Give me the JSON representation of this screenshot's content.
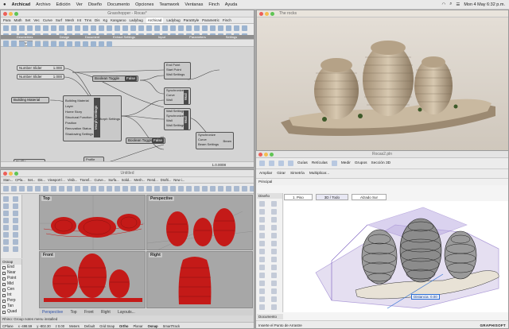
{
  "menubar": {
    "app": "Archicad",
    "items": [
      "Archivo",
      "Edición",
      "Ver",
      "Diseño",
      "Documento",
      "Opciones",
      "Teamwork",
      "Ventanas",
      "Finch",
      "Ayuda"
    ],
    "datetime": "Mon 4 May 6:32 p.m."
  },
  "gh": {
    "title": "Grasshopper - Rocas*",
    "tabs": [
      "Para",
      "Math",
      "Set",
      "Vec",
      "Curve",
      "Surf",
      "Mesh",
      "Int",
      "Trns",
      "Dis",
      "Kg",
      "Kangaroo",
      "Ladybug",
      "Archicad",
      "Ladybug",
      "ParaStyle",
      "Parametric",
      "Finch"
    ],
    "panels": [
      "Geometries",
      "Design",
      "Document",
      "Extract Settings",
      "Input",
      "Parameters",
      "Settings"
    ],
    "zoom": "85%",
    "sliders": [
      {
        "label": "Number Slider",
        "value": "1.000"
      },
      {
        "label": "Number Slider",
        "value": "1.000"
      }
    ],
    "building_material": "Building Material",
    "profile": "Profile",
    "boolean_toggle_1": "Boolean Toggle",
    "boolean_toggle_1_value": "False",
    "boolean_toggle_2": "Boolean Toggle",
    "boolean_toggle_2_value": "False",
    "morph_label": "Morph Settings",
    "morph_inputs": [
      "Building Material",
      "Layer",
      "Home Story",
      "Structural Function",
      "Position",
      "Renovation Status",
      "Shadowing Settings"
    ],
    "morph_output": "Morph Settings",
    "wall_inputs_1": [
      "End Point",
      "Start Point",
      "Wall Settings"
    ],
    "wall_inputs_2": [
      "Synchronize",
      "Curve",
      "Wall"
    ],
    "wall_label_1": "Wall",
    "wall_inputs_3": [
      "Wall Settings",
      "Synchronize",
      "Wall",
      "Wall Settings"
    ],
    "wall_label_2": "Wall",
    "beam_inputs": [
      "Synchronize",
      "Curve",
      "Beam Settings"
    ],
    "beam_output": "Beam",
    "profile_inputs": [
      "Profile",
      "Height"
    ],
    "status": "1.0.0008"
  },
  "render": {
    "title": "The rocks"
  },
  "rhino": {
    "title": "Untitled",
    "tabs": [
      "Stan...",
      "CPla...",
      "Set...",
      "Dis...",
      "Viewport l...",
      "Visib...",
      "Transf...",
      "Curve...",
      "Surfa...",
      "Solid...",
      "Mesh...",
      "Rend...",
      "Drafti...",
      "New i..."
    ],
    "viewports": [
      "Top",
      "Perspective",
      "Front",
      "Right"
    ],
    "vp_tabs": [
      "Perspective",
      "Top",
      "Front",
      "Right",
      "Layouts..."
    ],
    "osnap_title": "Osnap",
    "osnap": [
      "End",
      "Near",
      "Point",
      "Mid",
      "Cen",
      "Int",
      "Perp",
      "Tan",
      "Quad"
    ],
    "command_line": "Rhino: Group notes menu installed",
    "status_items": [
      "CPlane",
      "x -498.59",
      "y -802.30",
      "z 0.00",
      "Meters",
      "Default",
      "Grid Snap",
      "Ortho",
      "Planar",
      "Osnap",
      "SmartTrack"
    ]
  },
  "ac": {
    "title": "Rocas2.pln",
    "tb1": [
      "Guías",
      "Retículas",
      "Medir",
      "Grupos",
      "Sección 3D"
    ],
    "tb2": [
      "Ampliar",
      "Girar",
      "Simetría",
      "Multiplicar..."
    ],
    "tabs": [
      "1. Piso",
      "3D / Todo",
      "Alzado Sur"
    ],
    "tool_label": "Principal",
    "sections": [
      "Diseño",
      "Documento"
    ],
    "distance_label": "Distancia: 0.00",
    "prompt": "Inserte el Punto de Arrastre",
    "brand": "GRAPHISOFT"
  },
  "colors": {
    "red": "#c41a18",
    "purple": "#7a5cc0",
    "gh_bg": "#d4d4d4",
    "rhino_bg": "#a7a7a7"
  }
}
